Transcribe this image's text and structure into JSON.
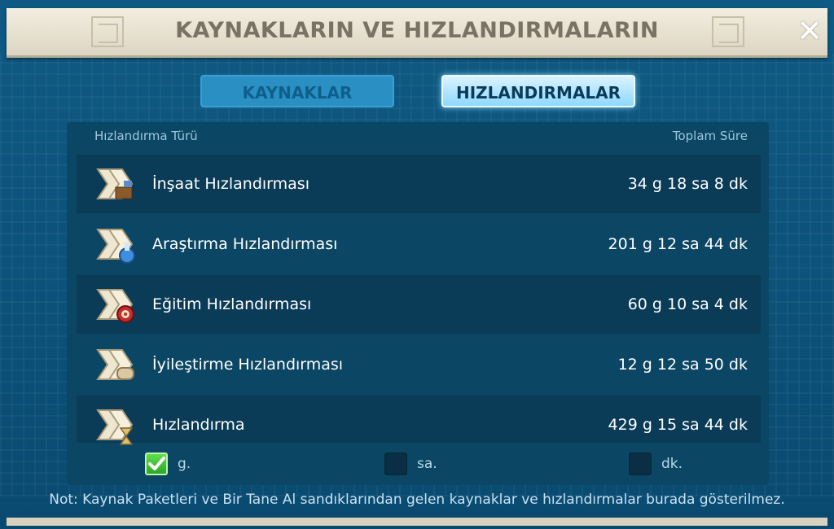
{
  "title": "KAYNAKLARIN VE HIZLANDIRMALARIN",
  "tabs": [
    {
      "label": "KAYNAKLAR",
      "active": false
    },
    {
      "label": "HIZLANDIRMALAR",
      "active": true
    }
  ],
  "table": {
    "col_type": "Hızlandırma Türü",
    "col_total": "Toplam Süre",
    "rows": [
      {
        "icon": "construction-speedup-icon",
        "name": "İnşaat Hızlandırması",
        "value": "34 g 18 sa 8 dk"
      },
      {
        "icon": "research-speedup-icon",
        "name": "Araştırma Hızlandırması",
        "value": "201 g 12 sa 44 dk"
      },
      {
        "icon": "training-speedup-icon",
        "name": "Eğitim Hızlandırması",
        "value": "60 g 10 sa 4 dk"
      },
      {
        "icon": "healing-speedup-icon",
        "name": "İyileştirme Hızlandırması",
        "value": "12 g 12 sa 50 dk"
      },
      {
        "icon": "universal-speedup-icon",
        "name": "Hızlandırma",
        "value": "429 g 15 sa 44 dk"
      }
    ]
  },
  "units": [
    {
      "label": "g.",
      "checked": true
    },
    {
      "label": "sa.",
      "checked": false
    },
    {
      "label": "dk.",
      "checked": false
    }
  ],
  "note": "Not: Kaynak Paketleri ve Bir Tane Al sandıklarından gelen kaynaklar ve hızlandırmalar burada gösterilmez.",
  "colors": {
    "accent": "#8fd8ff",
    "panel": "#0b4664",
    "check_on": "#3cc234"
  }
}
